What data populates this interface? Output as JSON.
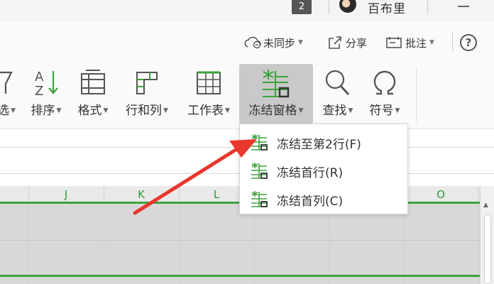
{
  "titlebar": {
    "window_count": "2",
    "user_name": "百布里"
  },
  "collab": {
    "sync_label": "未同步",
    "share_label": "分享",
    "comment_label": "批注",
    "help_label": "?"
  },
  "ribbon": {
    "items": [
      {
        "label": "选",
        "icon": "filter-icon"
      },
      {
        "label": "排序",
        "icon": "sort-az-icon"
      },
      {
        "label": "格式",
        "icon": "format-icon"
      },
      {
        "label": "行和列",
        "icon": "rows-columns-icon"
      },
      {
        "label": "工作表",
        "icon": "worksheet-icon"
      },
      {
        "label": "冻结窗格",
        "icon": "freeze-panes-icon",
        "active": true
      },
      {
        "label": "查找",
        "icon": "search-icon"
      },
      {
        "label": "符号",
        "icon": "omega-symbol-icon"
      }
    ]
  },
  "freeze_menu": {
    "items": [
      {
        "label": "冻结至第2行(F)",
        "icon": "freeze-to-row-icon"
      },
      {
        "label": "冻结首行(R)",
        "icon": "freeze-first-row-icon"
      },
      {
        "label": "冻结首列(C)",
        "icon": "freeze-first-column-icon"
      }
    ]
  },
  "grid": {
    "columns": [
      "J",
      "K",
      "L",
      "O"
    ]
  },
  "colors": {
    "accent_green": "#3ba33b",
    "header_text_green": "#2e9a3a",
    "arrow_red": "#e8372c",
    "active_button_bg": "#c9c9c9"
  }
}
